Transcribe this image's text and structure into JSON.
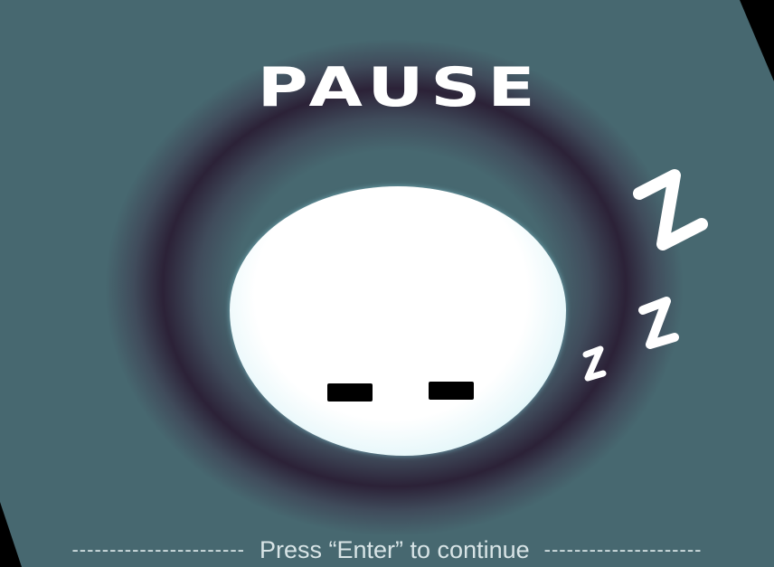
{
  "screen": {
    "title": "PAUSE",
    "prompt": "Press “Enter” to continue",
    "dashes_left": "-----------------------",
    "dashes_right": "---------------------"
  },
  "character": {
    "state": "sleeping",
    "zzz": [
      "Z",
      "Z",
      "z"
    ]
  },
  "colors": {
    "background": "#476870",
    "ring": "#2a1e34",
    "character": "#ffffff",
    "character_edge": "#7cc9d8",
    "text": "#ffffff"
  }
}
